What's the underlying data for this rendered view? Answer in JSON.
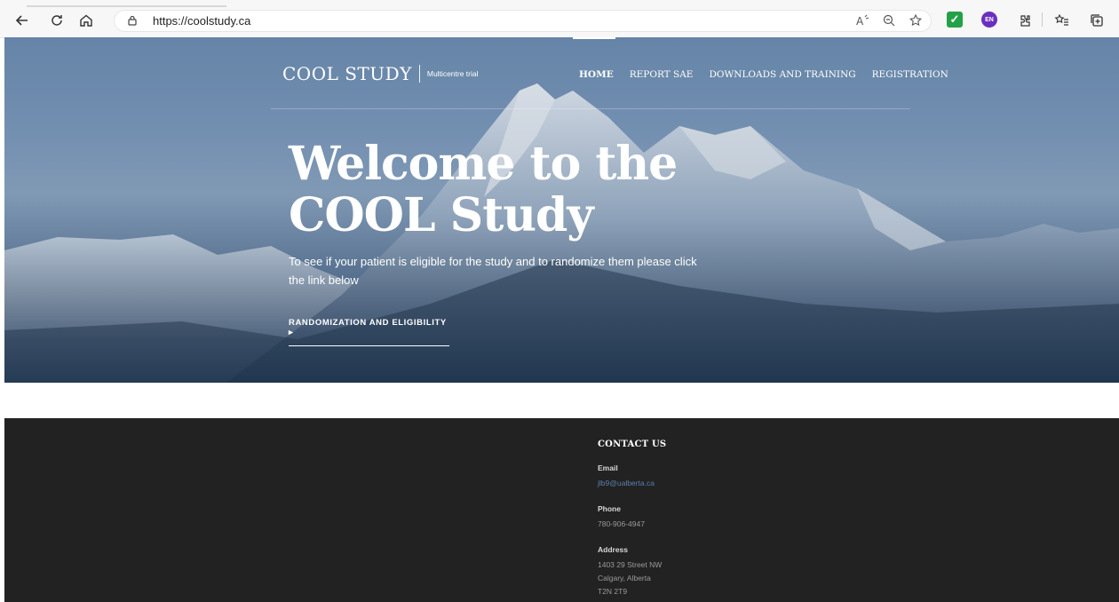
{
  "browser": {
    "url": "https://coolstudy.ca"
  },
  "site": {
    "logo_name": "COOL STUDY",
    "logo_tagline": "Multicentre trial",
    "nav": [
      {
        "label": "HOME",
        "active": true
      },
      {
        "label": "REPORT SAE",
        "active": false
      },
      {
        "label": "DOWNLOADS AND TRAINING",
        "active": false
      },
      {
        "label": "REGISTRATION",
        "active": false
      }
    ]
  },
  "hero": {
    "headline_line1": "Welcome to the",
    "headline_line2": "COOL Study",
    "lead": "To see if your patient is eligible for the study and to randomize them please click the link below",
    "cta": "RANDOMIZATION AND ELIGIBILITY ▸"
  },
  "footer": {
    "heading": "CONTACT US",
    "email_label": "Email",
    "email": "jlb9@ualberta.ca",
    "phone_label": "Phone",
    "phone": "780-906-4947",
    "address_label": "Address",
    "address_line1": "1403 29 Street NW",
    "address_line2": "Calgary, Alberta",
    "address_line3": "T2N 2T9"
  },
  "colors": {
    "footer_bg": "#222222",
    "link": "#5b7fae",
    "ext_green": "#24a148",
    "ext_purple": "#6b2fbf"
  },
  "extension_badges": {
    "language": "EN"
  },
  "icons": [
    "back-arrow-icon",
    "refresh-icon",
    "home-icon",
    "lock-icon",
    "read-aloud-icon",
    "zoom-icon",
    "favorite-add-icon",
    "checkmark-extension-icon",
    "language-extension-icon",
    "extensions-icon",
    "favorites-icon",
    "collections-icon"
  ]
}
